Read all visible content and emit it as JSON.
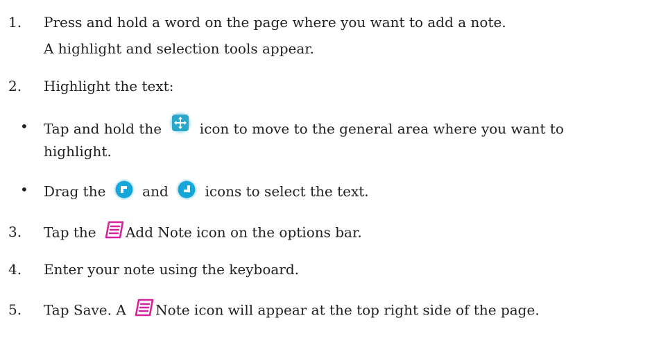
{
  "steps": [
    {
      "marker": "1.",
      "text": "Press and hold a word on the page where you want to add a note."
    },
    {
      "continuation": "A highlight and selection tools appear."
    },
    {
      "marker": "2.",
      "text": "Highlight the text:"
    },
    {
      "marker": "3.",
      "text_before": "Tap the",
      "text_after": "Add Note icon on the options bar."
    },
    {
      "marker": "4.",
      "text": "Enter your note using the keyboard."
    },
    {
      "marker": "5.",
      "text_before": "Tap Save.  A",
      "text_after": "Note icon will appear at the top right side of the page."
    }
  ],
  "bullets": [
    {
      "dot": "•",
      "text_before": "Tap and hold the",
      "text_after": "icon to move to the general area where you want to",
      "continuation": "highlight."
    },
    {
      "dot": "•",
      "text_before": "Drag the",
      "text_middle": "and",
      "text_after": "icons to select the text."
    }
  ],
  "icons": {
    "move": "move-icon",
    "start_handle": "selection-start-handle-icon",
    "end_handle": "selection-end-handle-icon",
    "add_note": "add-note-icon",
    "note": "note-icon"
  },
  "colors": {
    "text": "#231f20",
    "move_icon": "#2aa7c9",
    "handle_icon": "#16a6d9",
    "note_icon": "#d6259b"
  }
}
